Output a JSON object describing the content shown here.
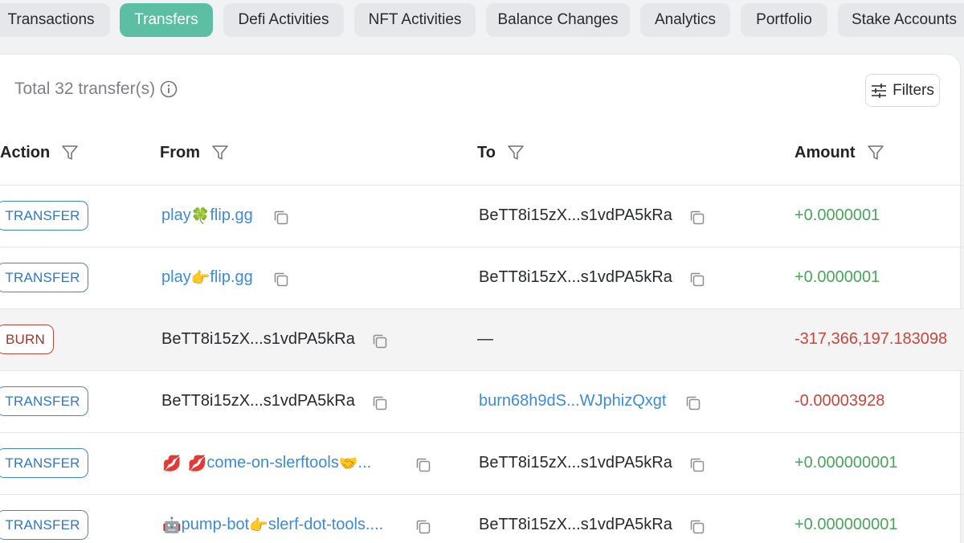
{
  "tabs": [
    {
      "label": "Transactions"
    },
    {
      "label": "Transfers",
      "active": true
    },
    {
      "label": "Defi Activities"
    },
    {
      "label": "NFT Activities"
    },
    {
      "label": "Balance Changes"
    },
    {
      "label": "Analytics"
    },
    {
      "label": "Portfolio"
    },
    {
      "label": "Stake Accounts"
    }
  ],
  "summary": {
    "total_text": "Total 32 transfer(s)",
    "filters_label": "Filters"
  },
  "columns": {
    "action": "Action",
    "from": "From",
    "to": "To",
    "amount": "Amount"
  },
  "rows": [
    {
      "action": "TRANSFER",
      "from_pre": "play",
      "from_emoji": "🍀",
      "from_post": "flip.gg",
      "to": "BeTT8i15zX...s1vdPA5kRa",
      "amount": "+0.0000001"
    },
    {
      "action": "TRANSFER",
      "from_pre": "play",
      "from_emoji": "👉",
      "from_post": "flip.gg",
      "to": "BeTT8i15zX...s1vdPA5kRa",
      "amount": "+0.0000001"
    },
    {
      "action": "BURN",
      "from": "BeTT8i15zX...s1vdPA5kRa",
      "to": "—",
      "amount": "-317,366,197.183098"
    },
    {
      "action": "TRANSFER",
      "from": "BeTT8i15zX...s1vdPA5kRa",
      "to": "burn68h9dS...WJphizQxgt",
      "amount": "-0.00003928"
    },
    {
      "action": "TRANSFER",
      "from_emoji_a": "💋",
      "from_emoji_b": "💋",
      "from_pre": "come-on-slerftools",
      "from_emoji": "🤝",
      "from_post": "...",
      "to": "BeTT8i15zX...s1vdPA5kRa",
      "amount": "+0.000000001"
    },
    {
      "action": "TRANSFER",
      "from_emoji_a": "🤖",
      "from_pre": "pump-bot",
      "from_emoji": "👉",
      "from_post": "slerf-dot-tools....",
      "to": "BeTT8i15zX...s1vdPA5kRa",
      "amount": "+0.000000001"
    }
  ],
  "colors": {
    "accent": "#5cbfa3",
    "link": "#3d8ad8",
    "positive": "#4aa55a",
    "negative": "#c8463d"
  },
  "icons": {
    "info": "info-circle-icon",
    "filters": "sliders-icon",
    "column_filter": "funnel-icon",
    "copy": "copy-icon"
  }
}
